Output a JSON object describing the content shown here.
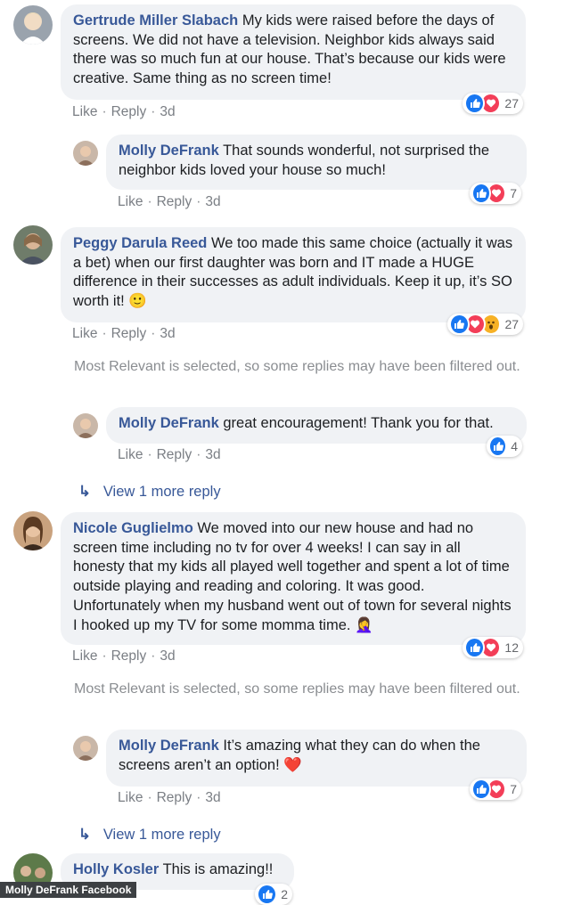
{
  "comments": [
    {
      "author": "Gertrude Miller Slabach",
      "text": " My kids were raised before the days of screens. We did not have a television. Neighbor kids always said there was so much fun at our house. That’s because our kids were creative. Same thing as no screen time!",
      "actions": {
        "like": "Like",
        "reply": "Reply",
        "time": "3d"
      },
      "reactions": {
        "types": [
          "like",
          "love"
        ],
        "count": "27"
      }
    },
    {
      "author": "Molly DeFrank",
      "text": " That sounds wonderful, not surprised the neighbor kids loved your house so much!",
      "actions": {
        "like": "Like",
        "reply": "Reply",
        "time": "3d"
      },
      "reactions": {
        "types": [
          "like",
          "love"
        ],
        "count": "7"
      }
    },
    {
      "author": "Peggy Darula Reed",
      "text": " We too made this same choice (actually it was a bet) when our first daughter was born and IT made a HUGE difference in their successes as adult individuals. Keep it up, it’s SO worth it! ",
      "emoji": "🙂",
      "actions": {
        "like": "Like",
        "reply": "Reply",
        "time": "3d"
      },
      "reactions": {
        "types": [
          "like",
          "love",
          "wow"
        ],
        "count": "27"
      }
    },
    {
      "author": "Molly DeFrank",
      "text": " great encouragement! Thank you for that.",
      "actions": {
        "like": "Like",
        "reply": "Reply",
        "time": "3d"
      },
      "reactions": {
        "types": [
          "like"
        ],
        "count": "4"
      }
    },
    {
      "author": "Nicole Guglielmo",
      "text": " We moved into our new house and had no screen time including no tv for over 4 weeks! I can say in all honesty that my kids all played well together and spent a lot of time outside playing and reading and coloring. It was good. Unfortunately when my husband went out of town for several nights I hooked up my TV for some momma time. ",
      "emoji": "🤦‍♀️",
      "actions": {
        "like": "Like",
        "reply": "Reply",
        "time": "3d"
      },
      "reactions": {
        "types": [
          "like",
          "love"
        ],
        "count": "12"
      }
    },
    {
      "author": "Molly DeFrank",
      "text": " It’s amazing what they can do when the screens aren’t an option! ",
      "emoji": "❤️",
      "actions": {
        "like": "Like",
        "reply": "Reply",
        "time": "3d"
      },
      "reactions": {
        "types": [
          "like",
          "love"
        ],
        "count": "7"
      }
    },
    {
      "author": "Holly Kosler",
      "text": " This is amazing!!",
      "reactions": {
        "types": [
          "like"
        ],
        "count": "2"
      }
    }
  ],
  "notices": {
    "filtered": "Most Relevant is selected, so some replies may have been filtered out."
  },
  "view_more": {
    "arrow": "↳",
    "label": "View 1 more reply"
  },
  "footer": {
    "credit": "Molly DeFrank Facebook"
  },
  "colors": {
    "author": "#385898",
    "bubble": "#f0f2f5",
    "like": "#1877f2",
    "love": "#f33e58",
    "wow": "#f7b125"
  }
}
